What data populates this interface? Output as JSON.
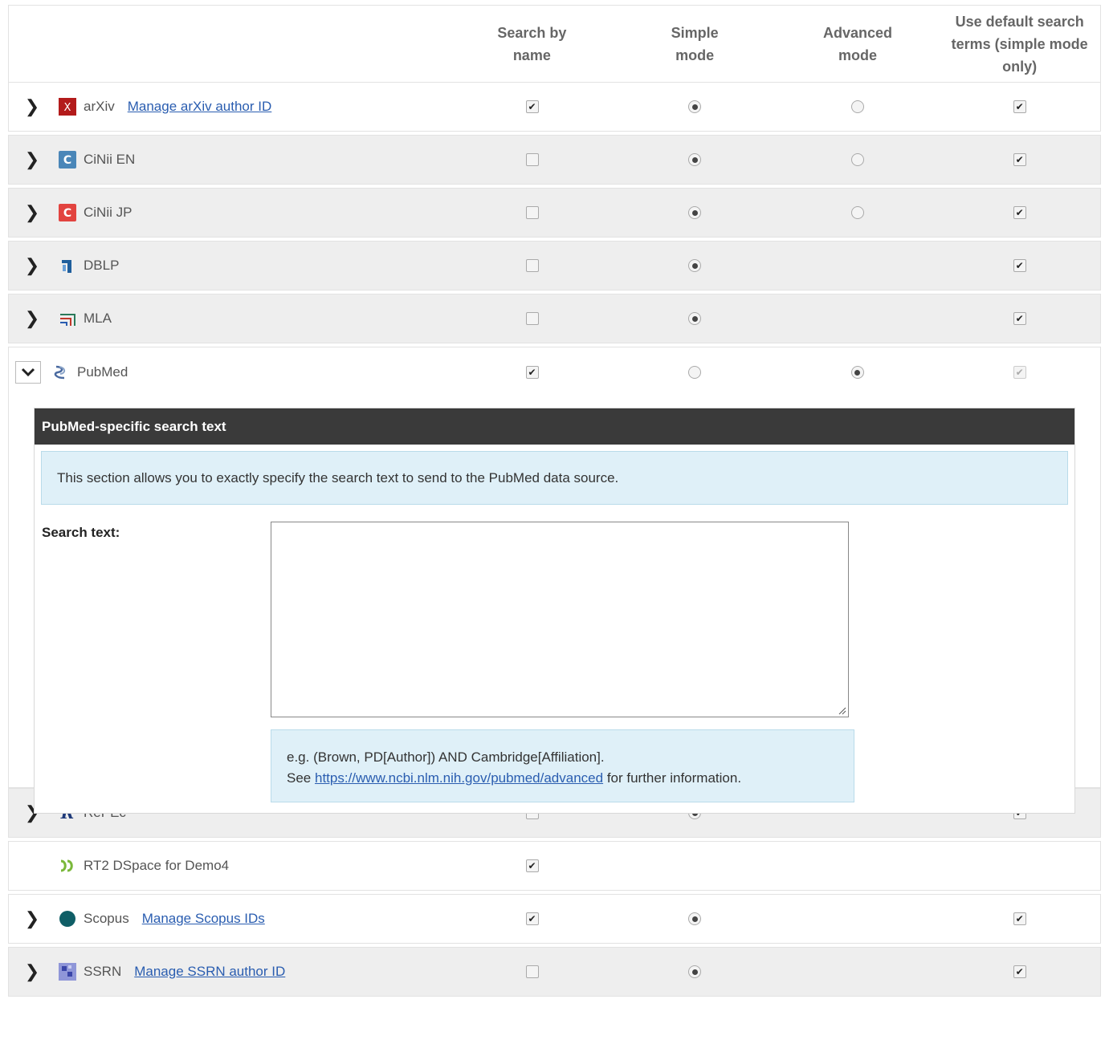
{
  "columns": {
    "search_by_name": "Search by name",
    "simple_mode": "Simple mode",
    "advanced_mode": "Advanced mode",
    "use_default": "Use default search terms (simple mode only)"
  },
  "sources": [
    {
      "name": "arXiv",
      "link": "Manage arXiv author ID"
    },
    {
      "name": "CiNii EN"
    },
    {
      "name": "CiNii JP"
    },
    {
      "name": "DBLP"
    },
    {
      "name": "MLA"
    },
    {
      "name": "PubMed"
    },
    {
      "name": "RePEc"
    },
    {
      "name": "RT2 DSpace for Demo4"
    },
    {
      "name": "Scopus",
      "link": "Manage Scopus IDs"
    },
    {
      "name": "SSRN",
      "link": "Manage SSRN author ID"
    }
  ],
  "pubmed_panel": {
    "title": "PubMed-specific search text",
    "info": "This section allows you to exactly specify the search text to send to the PubMed data source.",
    "label": "Search text:",
    "hint_line1": "e.g. (Brown, PD[Author]) AND Cambridge[Affiliation].",
    "hint_see": "See",
    "hint_url": "https://www.ncbi.nlm.nih.gov/pubmed/advanced",
    "hint_tail": "for further information."
  }
}
